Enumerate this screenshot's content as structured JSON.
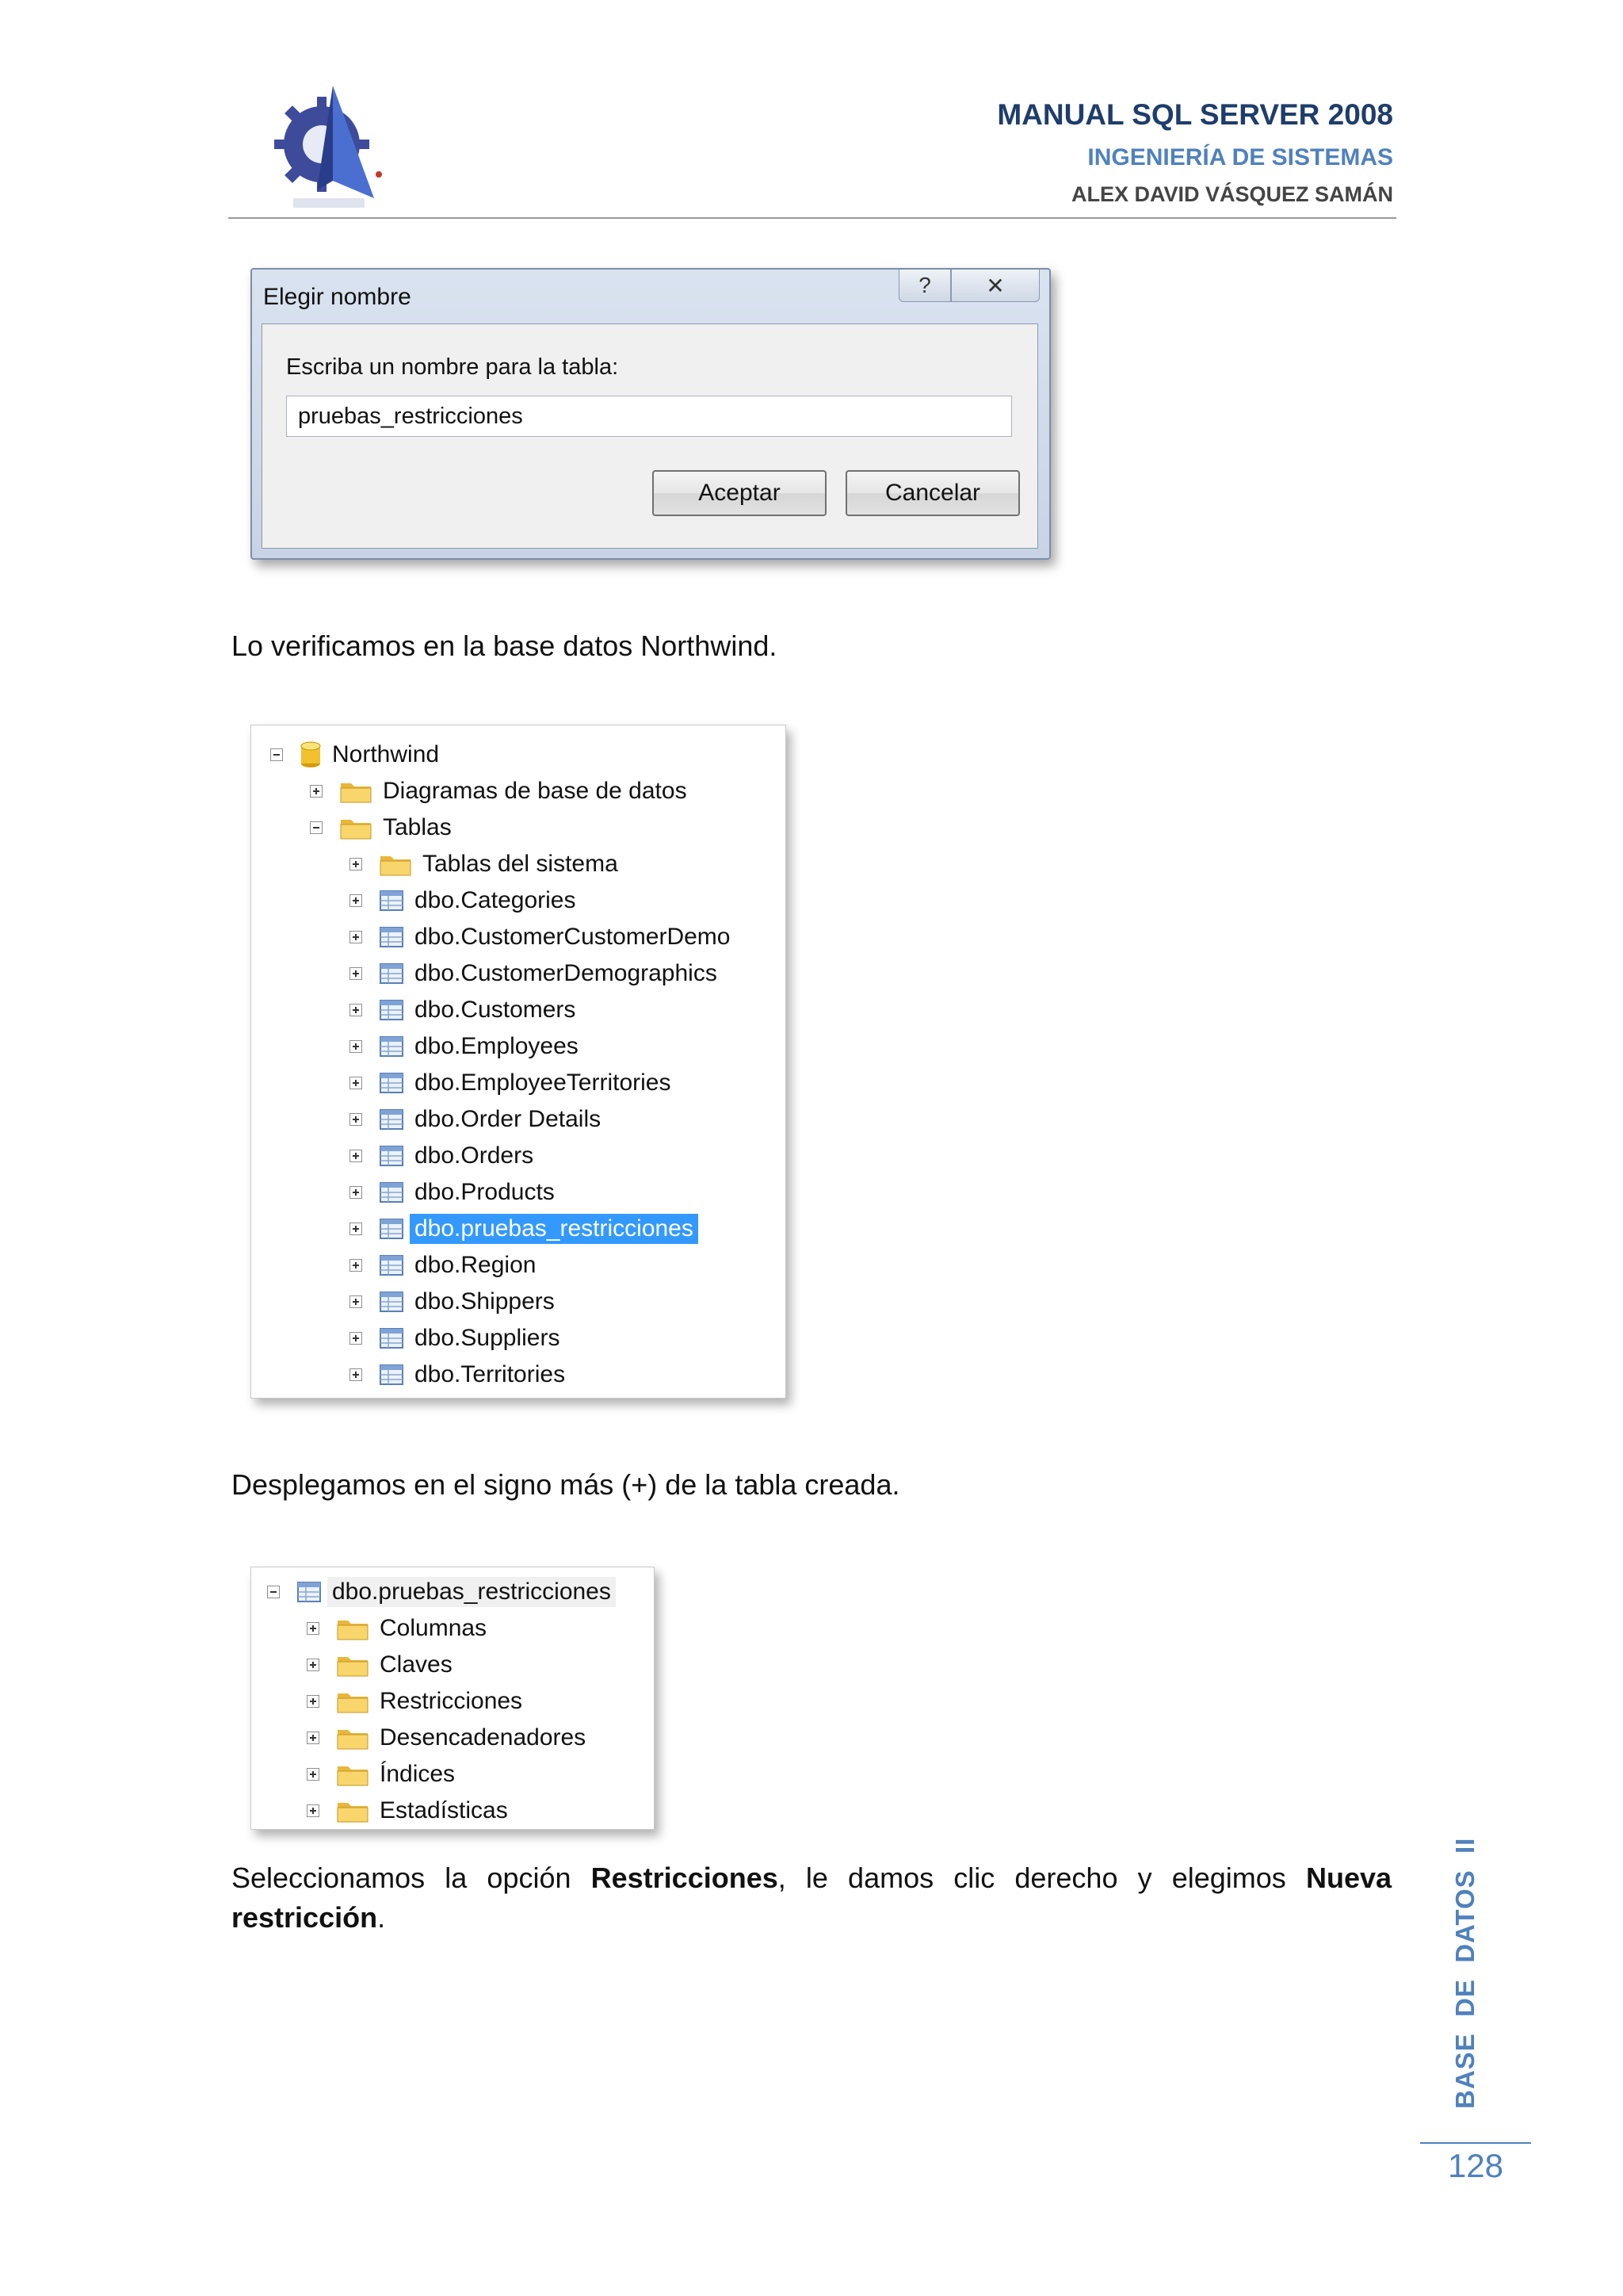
{
  "header": {
    "title": "MANUAL SQL SERVER 2008",
    "subtitle": "INGENIERÍA DE SISTEMAS",
    "author": "ALEX DAVID VÁSQUEZ SAMÁN"
  },
  "dialog": {
    "title": "Elegir nombre",
    "help_glyph": "?",
    "close_glyph": "✕",
    "label": "Escriba un nombre para la tabla:",
    "input_value": "pruebas_restricciones",
    "ok_label": "Aceptar",
    "cancel_label": "Cancelar"
  },
  "text": {
    "p1": "Lo verificamos en la base datos Northwind.",
    "p2": "Desplegamos en el signo más (+) de la tabla creada.",
    "p3_a": "Seleccionamos la opción ",
    "p3_b": "Restricciones",
    "p3_c": ", le damos clic derecho y elegimos ",
    "p3_d": "Nueva restricción",
    "p3_e": "."
  },
  "tree1": {
    "root": "Northwind",
    "diagramas": "Diagramas de base de datos",
    "tablas": "Tablas",
    "sistema": "Tablas del sistema",
    "tables": [
      "dbo.Categories",
      "dbo.CustomerCustomerDemo",
      "dbo.CustomerDemographics",
      "dbo.Customers",
      "dbo.Employees",
      "dbo.EmployeeTerritories",
      "dbo.Order Details",
      "dbo.Orders",
      "dbo.Products",
      "dbo.pruebas_restricciones",
      "dbo.Region",
      "dbo.Shippers",
      "dbo.Suppliers",
      "dbo.Territories"
    ],
    "selected_index": 9
  },
  "tree2": {
    "root": "dbo.pruebas_restricciones",
    "folders": [
      "Columnas",
      "Claves",
      "Restricciones",
      "Desencadenadores",
      "Índices",
      "Estadísticas"
    ]
  },
  "footer": {
    "side_text": "BASE  DE  DATOS  II",
    "page_number": "128"
  },
  "colors": {
    "accent": "#4f81bd",
    "title": "#1f3d6b",
    "selection": "#3399ff"
  }
}
